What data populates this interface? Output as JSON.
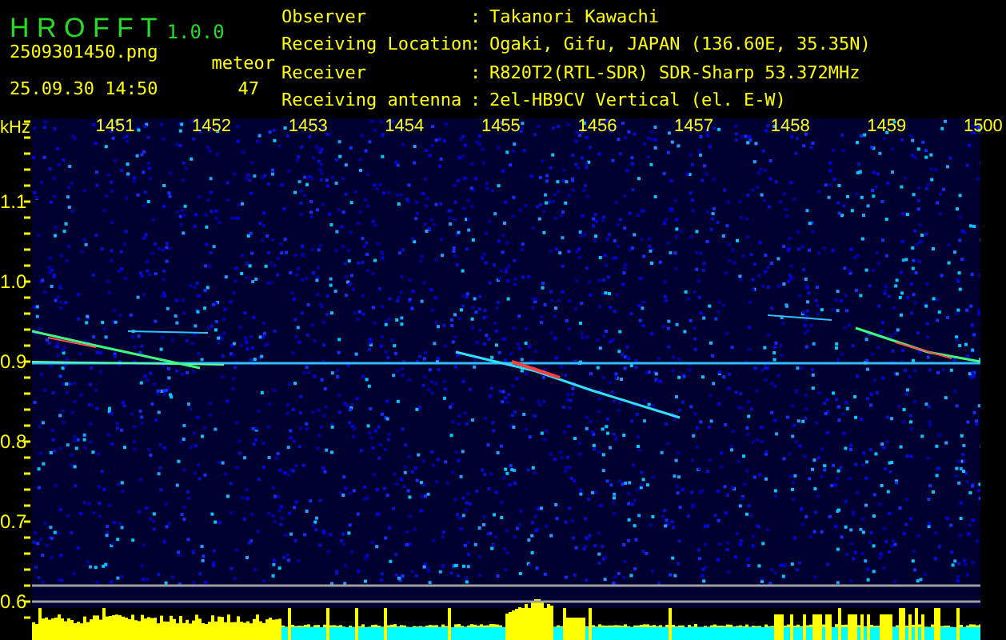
{
  "app": {
    "name": "H R O F F T",
    "version": "1.0.0"
  },
  "file_name": "2509301450.png",
  "timestamp": "25.09.30 14:50",
  "detection": {
    "label": "meteor",
    "count": "47"
  },
  "station_info": [
    {
      "label": "Observer",
      "separator": ":",
      "value": "Takanori Kawachi"
    },
    {
      "label": "Receiving Location",
      "separator": ":",
      "value": "Ogaki, Gifu, JAPAN (136.60E, 35.35N)"
    },
    {
      "label": "Receiver",
      "separator": ":",
      "value": "R820T2(RTL-SDR) SDR-Sharp 53.372MHz"
    },
    {
      "label": "Receiving antenna",
      "separator": ":",
      "value": "2el-HB9CV Vertical (el. E-W)"
    }
  ],
  "spectrogram": {
    "frequency_unit": "kHz",
    "frequency_ticks": [
      "1451",
      "1452",
      "1453",
      "1454",
      "1455",
      "1456",
      "1457",
      "1458",
      "1459",
      "1500"
    ],
    "level_ticks": [
      "1.1",
      "1.0",
      "0.9",
      "0.8",
      "0.7",
      "0.6"
    ]
  }
}
